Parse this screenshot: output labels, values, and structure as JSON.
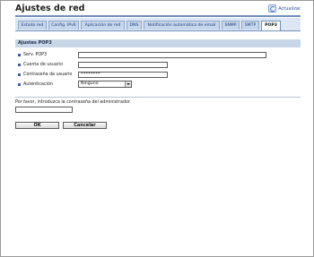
{
  "page": {
    "title": "Ajustes de red",
    "refresh_label": "Actualizar"
  },
  "tabs": [
    {
      "label": "Estado red",
      "active": false
    },
    {
      "label": "Config. IPv6",
      "active": false
    },
    {
      "label": "Aplicación de red",
      "active": false
    },
    {
      "label": "DNS",
      "active": false
    },
    {
      "label": "Notificación automática de email",
      "active": false
    },
    {
      "label": "SNMP",
      "active": false
    },
    {
      "label": "SMTP",
      "active": false
    },
    {
      "label": "POP3",
      "active": true
    }
  ],
  "section": {
    "title": "Ajustes POP3"
  },
  "fields": {
    "server": {
      "label": "Serv. POP3",
      "value": ""
    },
    "user": {
      "label": "Cuenta de usuario",
      "value": ""
    },
    "password": {
      "label": "Contraseña de usuario",
      "value": "********"
    },
    "auth": {
      "label": "Autenticación",
      "value": "Ninguno"
    }
  },
  "admin": {
    "prompt": "Por favor, introduzca la contraseña del administrador.",
    "value": ""
  },
  "buttons": {
    "ok": "OK",
    "cancel": "Cancelar"
  },
  "colors": {
    "accent": "#6f8fb8",
    "tab_bg": "#c6d6ec",
    "section_bg": "#c9d6e8"
  }
}
